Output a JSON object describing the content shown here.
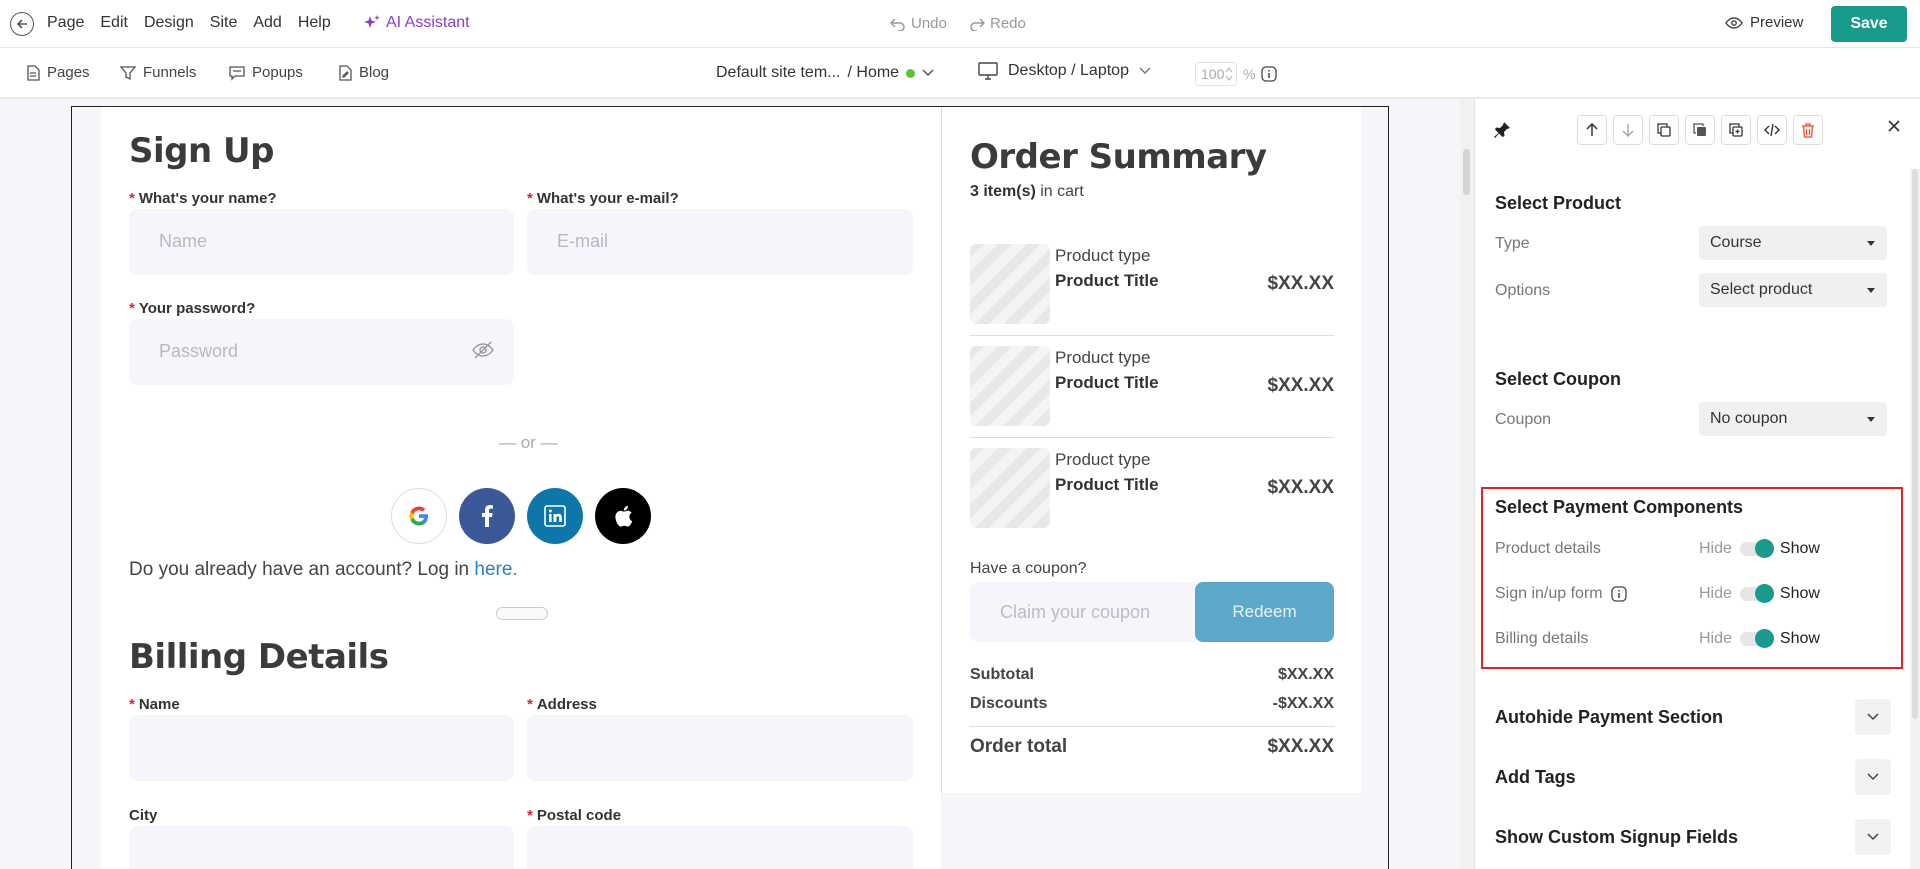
{
  "app": {
    "menu": [
      "Page",
      "Edit",
      "Design",
      "Site",
      "Add",
      "Help"
    ],
    "ai_label": "AI Assistant",
    "undo_label": "Undo",
    "redo_label": "Redo",
    "preview_label": "Preview",
    "save_label": "Save"
  },
  "toolbar": {
    "tabs": [
      "Pages",
      "Funnels",
      "Popups",
      "Blog"
    ],
    "site_template": "Default site tem...",
    "site_page": "/ Home",
    "device": "Desktop / Laptop",
    "zoom_value": "100",
    "zoom_unit": "%"
  },
  "signup": {
    "title": "Sign Up",
    "name_label": "What's your name?",
    "name_placeholder": "Name",
    "email_label": "What's your e-mail?",
    "email_placeholder": "E-mail",
    "password_label": "Your password?",
    "password_placeholder": "Password",
    "or_text": "— or —",
    "login_prefix": "Do you already have an account? Log in ",
    "login_link": "here."
  },
  "billing": {
    "title": "Billing Details",
    "name_label": "Name",
    "address_label": "Address",
    "city_label": "City",
    "postal_label": "Postal code"
  },
  "order": {
    "title": "Order Summary",
    "count_bold": "3 item(s)",
    "count_suffix": " in cart",
    "products": [
      {
        "type": "Product type",
        "title": "Product Title",
        "price": "$XX.XX"
      },
      {
        "type": "Product type",
        "title": "Product Title",
        "price": "$XX.XX"
      },
      {
        "type": "Product type",
        "title": "Product Title",
        "price": "$XX.XX"
      }
    ],
    "coupon_label": "Have a coupon?",
    "coupon_placeholder": "Claim your coupon",
    "redeem_label": "Redeem",
    "subtotal_label": "Subtotal",
    "subtotal_value": "$XX.XX",
    "discounts_label": "Discounts",
    "discounts_value": "-$XX.XX",
    "total_label": "Order total",
    "total_value": "$XX.XX"
  },
  "panel": {
    "select_product_title": "Select Product",
    "type_label": "Type",
    "type_value": "Course",
    "options_label": "Options",
    "options_value": "Select product",
    "select_coupon_title": "Select Coupon",
    "coupon_label": "Coupon",
    "coupon_value": "No coupon",
    "payment_title": "Select Payment Components",
    "payment_rows": [
      {
        "label": "Product details",
        "hide": "Hide",
        "show": "Show",
        "on": true
      },
      {
        "label": "Sign in/up form",
        "hide": "Hide",
        "show": "Show",
        "on": true
      },
      {
        "label": "Billing details",
        "hide": "Hide",
        "show": "Show",
        "on": true
      }
    ],
    "autohide_title": "Autohide Payment Section",
    "tags_title": "Add Tags",
    "custom_fields_title": "Show Custom Signup Fields"
  },
  "colors": {
    "accent": "#1a9a8c",
    "ai_purple": "#8a3ec8",
    "redeem": "#5ba8c8",
    "highlight_red": "#e02424",
    "link_blue": "#2c80c8"
  }
}
